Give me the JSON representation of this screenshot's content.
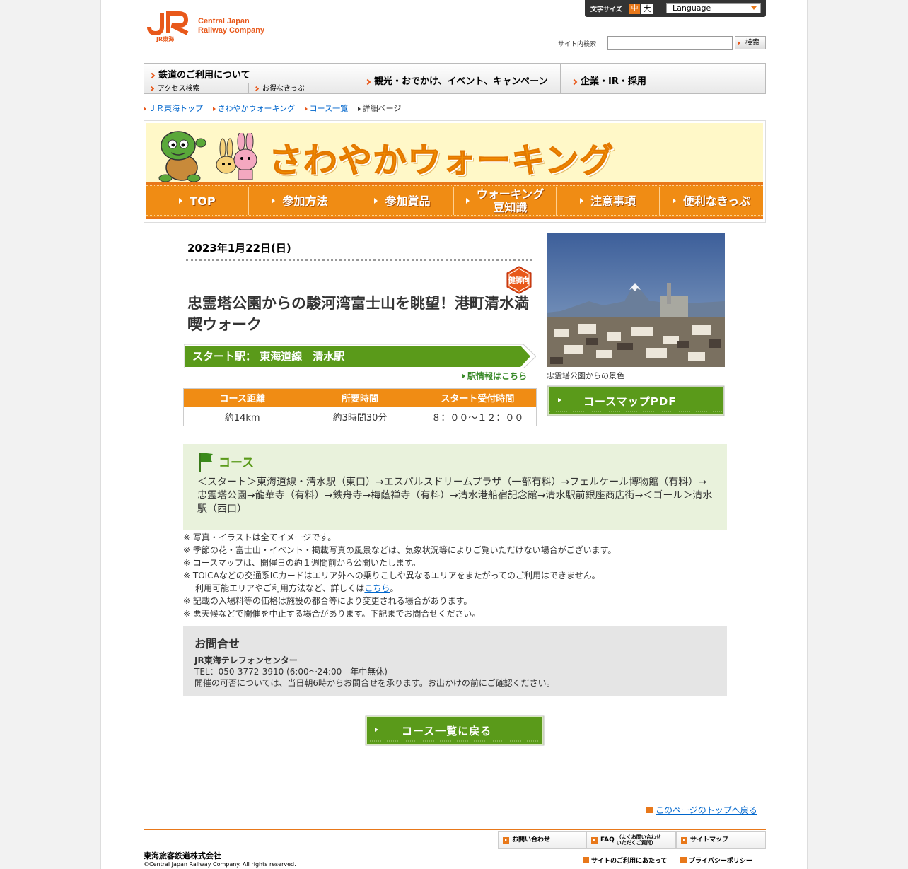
{
  "header": {
    "company_en_1": "Central Japan",
    "company_en_2": "Railway Company",
    "logo_sub": "JR東海",
    "font_size_label": "文字サイズ",
    "font_size_mid": "中",
    "font_size_big": "大",
    "language": "Language",
    "search_label": "サイト内検索",
    "search_value": "",
    "search_button": "検索"
  },
  "gnav": {
    "railway": "鉄道のご利用について",
    "access": "アクセス検索",
    "tickets": "お得なきっぷ",
    "tourism": "観光・おでかけ、イベント、キャンペーン",
    "corporate": "企業・IR・採用"
  },
  "breadcrumb": {
    "top": "ＪＲ東海トップ",
    "walking": "さわやかウォーキング",
    "list": "コース一覧",
    "current": "詳細ページ"
  },
  "banner": {
    "title": "さわやかウォーキング",
    "nav": [
      "TOP",
      "参加方法",
      "参加賞品",
      "ウォーキング豆知識",
      "注意事項",
      "便利なきっぷ"
    ],
    "nav_top": "TOP",
    "nav_join": "参加方法",
    "nav_prize": "参加賞品",
    "nav_tips_1": "ウォーキング",
    "nav_tips_2": "豆知識",
    "nav_caution": "注意事項",
    "nav_tickets": "便利なきっぷ"
  },
  "event": {
    "date": "2023年1月22日(日)",
    "badge": "健脚向",
    "title": "忠霊塔公園からの駿河湾富士山を眺望！港町清水満喫ウォーク",
    "start_label": "スタート駅：",
    "start_station": "東海道線　清水駅",
    "station_info": "駅情報はこちら",
    "table_headers": [
      "コース距離",
      "所要時間",
      "スタート受付時間"
    ],
    "distance": "約14km",
    "duration": "約3時間30分",
    "reception": "８：００～１２：００",
    "photo_caption": "忠霊塔公園からの景色",
    "pdf_button": "コースマップPDF"
  },
  "course": {
    "title": "コース",
    "text": "＜スタート＞東海道線・清水駅（東口）→エスパルスドリームプラザ（一部有料）→フェルケール博物館（有料）→忠霊塔公園→龍華寺（有料）→鉄舟寺→梅蔭禅寺（有料）→清水港船宿記念館→清水駅前銀座商店街→＜ゴール＞清水駅（西口）"
  },
  "notes": {
    "n1": "※ 写真・イラストは全てイメージです。",
    "n2": "※ 季節の花・富士山・イベント・掲載写真の風景などは、気象状況等によりご覧いただけない場合がございます。",
    "n3": "※ コースマップは、開催日の約１週間前から公開いたします。",
    "n4": "※ TOICAなどの交通系ICカードはエリア外への乗りこしや異なるエリアをまたがってのご利用はできません。",
    "n4b_prefix": "利用可能エリアやご利用方法など、詳しくは",
    "n4b_link": "こちら",
    "n4b_suffix": "。",
    "n5": "※ 記載の入場料等の価格は施設の都合等により変更される場合があります。",
    "n6": "※ 悪天候などで開催を中止する場合があります。下記までお問合せください。"
  },
  "contact": {
    "title": "お問合せ",
    "name": "JR東海テレフォンセンター",
    "tel": "TEL：050-3772-3910 (6:00～24:00　年中無休)",
    "note": "開催の可否については、当日朝6時からお問合せを承ります。お出かけの前にご確認ください。"
  },
  "back_button": "コース一覧に戻る",
  "to_top": "このページのトップへ戻る",
  "footer": {
    "inquiry": "お問い合わせ",
    "faq": "FAQ",
    "faq_sub_1": "（よくお問い合わせ",
    "faq_sub_2": "いただくご質問）",
    "sitemap": "サイトマップ",
    "company": "東海旅客鉄道株式会社",
    "copyright": "©Central Japan Railway Company. All rights reserved.",
    "terms": "サイトのご利用にあたって",
    "privacy": "プライバシーポリシー"
  },
  "colors": {
    "jr_orange": "#e8581a",
    "nav_orange": "#f08c14",
    "green": "#5a9a1a",
    "link": "#0066cc"
  }
}
